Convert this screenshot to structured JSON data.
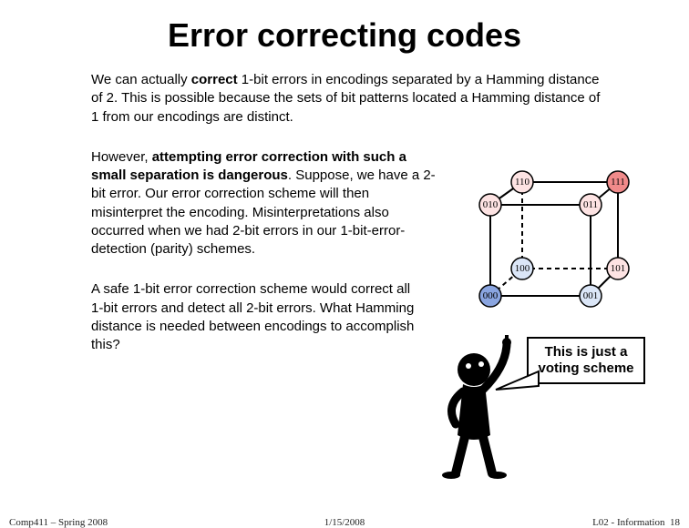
{
  "title": "Error correcting codes",
  "p1_a": "We can actually ",
  "p1_b": "correct",
  "p1_c": " 1-bit errors in encodings separated by a Hamming distance of 2. This is possible because the sets of bit patterns located a Hamming distance of 1 from our encodings are distinct.",
  "p2_a": "However, ",
  "p2_b": "attempting error correction with such a small separation is dangerous",
  "p2_c": ". Suppose, we have a 2-bit error. Our error correction scheme will then misinterpret the encoding. Misinterpretations also occurred when we had 2-bit errors in our 1-bit-error-detection (parity) schemes.",
  "p3": "A safe 1-bit error correction scheme would correct all 1-bit errors and detect all 2-bit errors. What Hamming distance is needed between encodings to accomplish this?",
  "speech": "This is just a voting scheme",
  "cube": {
    "n000": "000",
    "n001": "001",
    "n010": "010",
    "n011": "011",
    "n100": "100",
    "n101": "101",
    "n110": "110",
    "n111": "111"
  },
  "footer": {
    "left": "Comp411 – Spring 2008",
    "center": "1/15/2008",
    "right_a": "L02 - Information",
    "right_b": "18"
  }
}
